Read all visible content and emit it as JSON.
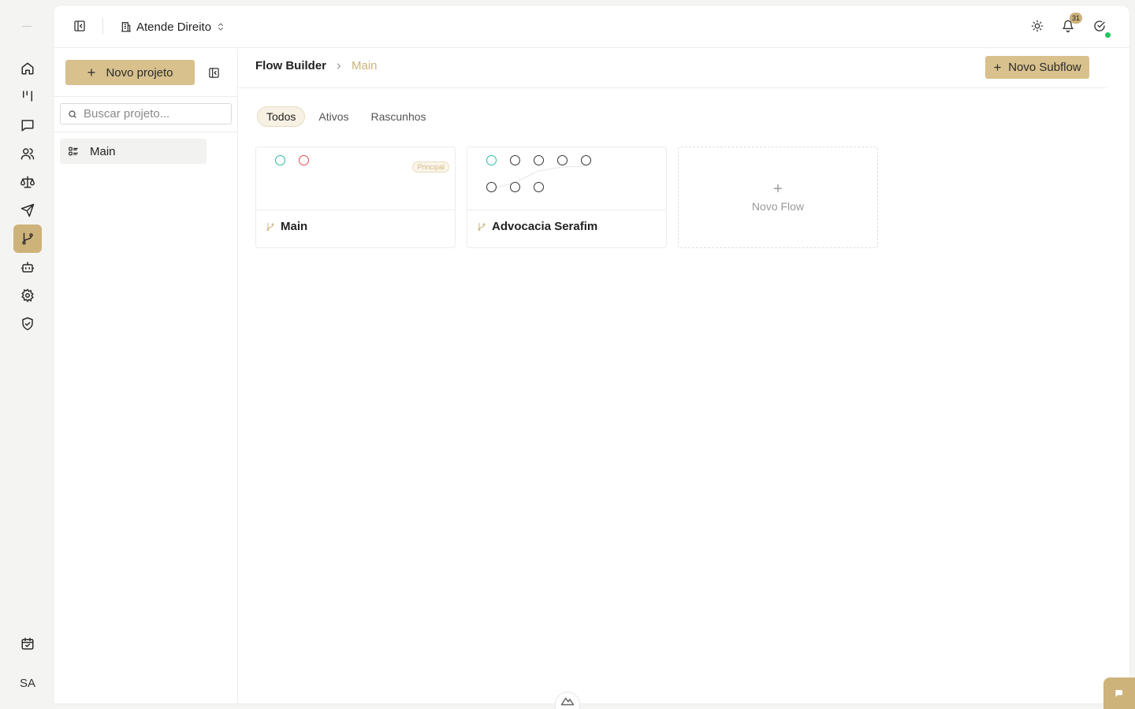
{
  "header": {
    "workspace": "Atende Direito",
    "notifications_count": "31"
  },
  "projects": {
    "new_button": "Novo projeto",
    "search_placeholder": "Buscar projeto...",
    "items": [
      {
        "label": "Main"
      }
    ]
  },
  "breadcrumb": {
    "root": "Flow Builder",
    "current": "Main"
  },
  "actions": {
    "new_subflow": "Novo Subflow"
  },
  "tabs": [
    {
      "label": "Todos",
      "active": true
    },
    {
      "label": "Ativos",
      "active": false
    },
    {
      "label": "Rascunhos",
      "active": false
    }
  ],
  "flows": [
    {
      "name": "Main",
      "tag": "Principal"
    },
    {
      "name": "Advocacia Serafim",
      "tag": ""
    }
  ],
  "new_flow": {
    "plus": "+",
    "label": "Novo Flow"
  },
  "user": {
    "initials": "SA"
  },
  "colors": {
    "accent": "#cdb27a",
    "accent_light": "#d8c18d",
    "node_start": "#2bbba3",
    "node_end": "#e04d4d",
    "online": "#22c55e"
  }
}
